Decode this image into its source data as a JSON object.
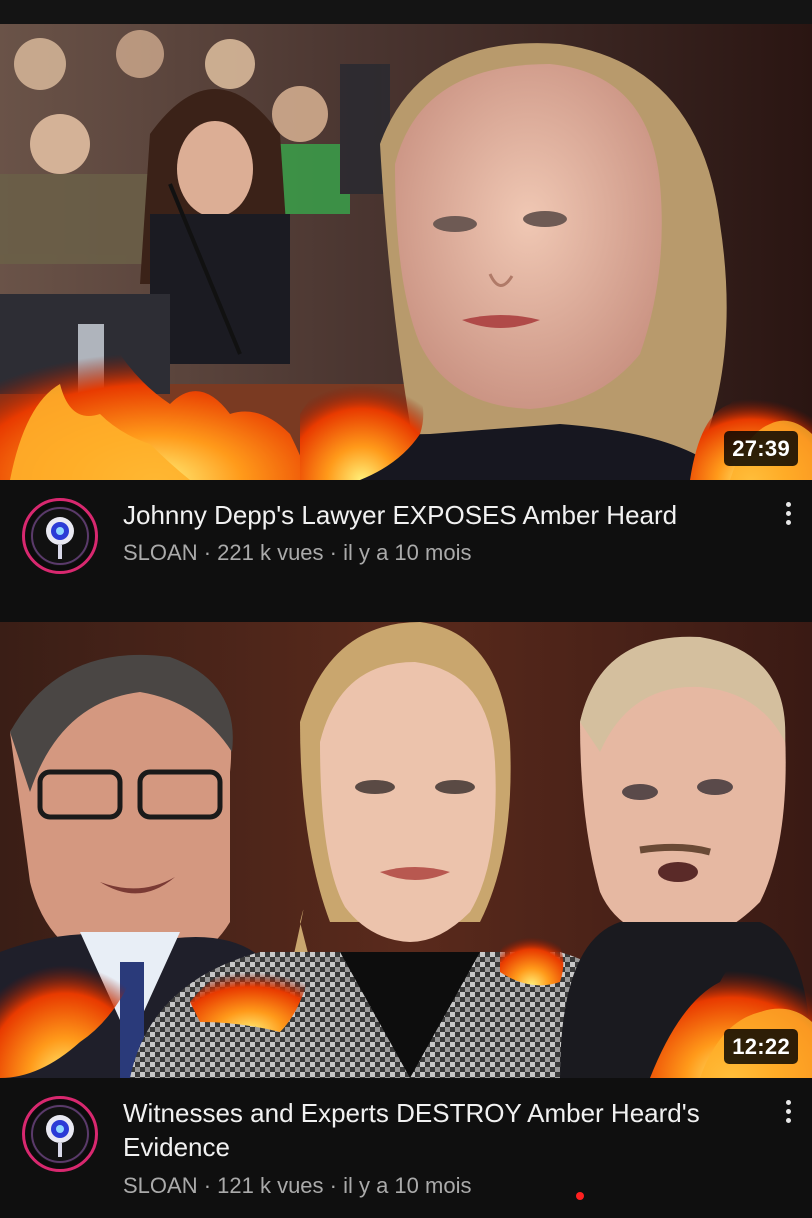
{
  "videos": [
    {
      "title": "Johnny Depp's Lawyer EXPOSES Amber Heard",
      "channel": "SLOAN",
      "views": "221 k vues",
      "age": "il y a 10 mois",
      "subtitle": "SLOAN · 221 k vues · il y a 10 mois",
      "duration": "27:39"
    },
    {
      "title": "Witnesses and Experts DESTROY Amber Heard's Evidence",
      "channel": "SLOAN",
      "views": "121 k vues",
      "age": "il y a 10 mois",
      "subtitle": "SLOAN · 121 k vues · il y a 10 mois",
      "duration": "12:22"
    }
  ],
  "colors": {
    "background": "#0f0f0f",
    "avatar_ring": "#d8286f",
    "subtitle_text": "#aaaaaa",
    "fire": "#ff6a00"
  },
  "icons": [
    "more-vert-icon",
    "channel-avatar-icon"
  ]
}
